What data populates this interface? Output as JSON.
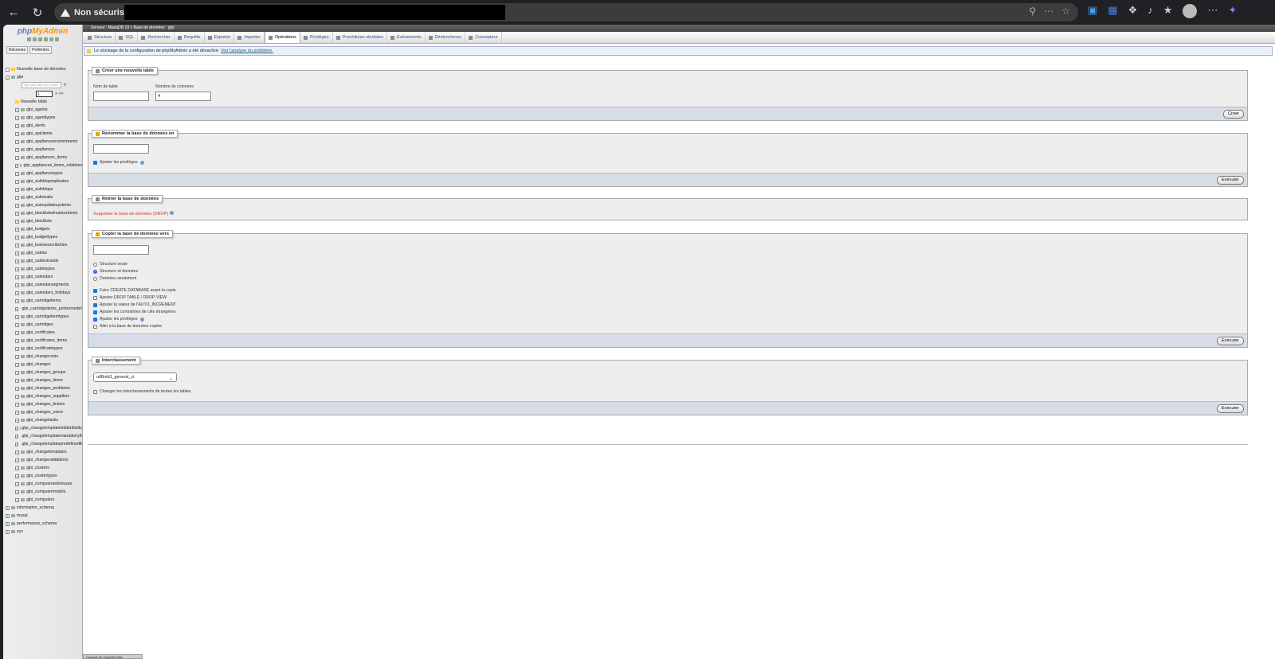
{
  "browser": {
    "security_label": "Non sécurisé"
  },
  "nav": {
    "logo_php": "php",
    "logo_myadmin": "MyAdmin",
    "recent_label": "Récentes",
    "favorites_label": "Préférées",
    "new_db": "Nouvelle base de données",
    "db_name": "glpi",
    "filter_placeholder": "Type your filter and, Enter",
    "filter_clear": "X",
    "pager_value": "1",
    "pager_next": "> >>",
    "new_table": "Nouvelle table",
    "tables": [
      "glpi_agents",
      "glpi_agenttypes",
      "glpi_alerts",
      "glpi_apiclients",
      "glpi_applianceenvironments",
      "glpi_appliances",
      "glpi_appliances_items",
      "glpi_appliances_items_relations",
      "glpi_appliancetypes",
      "glpi_authldapreplicates",
      "glpi_authldaps",
      "glpi_authmails",
      "glpi_autoupdatesystems",
      "glpi_blacklistedmailcontents",
      "glpi_blacklists",
      "glpi_budgets",
      "glpi_budgettypes",
      "glpi_businesscriticities",
      "glpi_cables",
      "glpi_cablestrands",
      "glpi_cabletypes",
      "glpi_calendars",
      "glpi_calendarsegments",
      "glpi_calendars_holidays",
      "glpi_cartridgeitems",
      "glpi_cartridgeitems_printermodels",
      "glpi_cartridgeitemtypes",
      "glpi_cartridges",
      "glpi_certificates",
      "glpi_certificates_items",
      "glpi_certificatetypes",
      "glpi_changecosts",
      "glpi_changes",
      "glpi_changes_groups",
      "glpi_changes_items",
      "glpi_changes_problems",
      "glpi_changes_suppliers",
      "glpi_changes_tickets",
      "glpi_changes_users",
      "glpi_changetasks",
      "glpi_changetemplatehiddenfields",
      "glpi_changetemplatemandatoryfields",
      "glpi_changetemplatepredefinedfields",
      "glpi_changetemplates",
      "glpi_changevalidations",
      "glpi_clusters",
      "glpi_clustertypes",
      "glpi_computerantiviruses",
      "glpi_computermodels",
      "glpi_computers"
    ],
    "other_dbs": [
      "information_schema",
      "mysql",
      "performance_schema",
      "sys"
    ]
  },
  "breadcrumb": {
    "server": "Serveur : MariaDB 10",
    "separator": "»",
    "database": "Base de données : glpi"
  },
  "tabs": [
    {
      "label": "Structure",
      "active": false
    },
    {
      "label": "SQL",
      "active": false
    },
    {
      "label": "Rechercher",
      "active": false
    },
    {
      "label": "Requête",
      "active": false
    },
    {
      "label": "Exporter",
      "active": false
    },
    {
      "label": "Importer",
      "active": false
    },
    {
      "label": "Opérations",
      "active": true
    },
    {
      "label": "Privilèges",
      "active": false
    },
    {
      "label": "Procédures stockées",
      "active": false
    },
    {
      "label": "Événements",
      "active": false
    },
    {
      "label": "Déclencheurs",
      "active": false
    },
    {
      "label": "Concepteur",
      "active": false
    }
  ],
  "notice": {
    "text": "Le stockage de la configuration de phpMyAdmin a été désactivé.",
    "link": "Voir l'analyse du problème."
  },
  "create_table": {
    "legend": "Créer une nouvelle table",
    "name_label": "Nom de table",
    "cols_label": "Nombre de colonnes",
    "name_value": "",
    "cols_value": "4",
    "button": "Créer"
  },
  "rename_db": {
    "legend": "Renommer la base de données en",
    "value": "",
    "adjust_priv": "Ajuster les privilèges",
    "button": "Exécuter"
  },
  "drop_db": {
    "legend": "Retirer la base de données",
    "link": "Supprimer la base de données (DROP)"
  },
  "copy_db": {
    "legend": "Copier la base de données vers",
    "value": "",
    "radios": [
      {
        "label": "Structure seule",
        "checked": false
      },
      {
        "label": "Structure et données",
        "checked": true
      },
      {
        "label": "Données seulement",
        "checked": false
      }
    ],
    "checks": [
      {
        "label": "Faire CREATE DATABASE avant la copie",
        "checked": true
      },
      {
        "label": "Ajouter DROP TABLE / DROP VIEW",
        "checked": false
      },
      {
        "label": "Ajouter la valeur de l'AUTO_INCREMENT",
        "checked": true
      },
      {
        "label": "Ajouter les contraintes de clés étrangères",
        "checked": true
      },
      {
        "label": "Ajuster les privilèges",
        "checked": true
      },
      {
        "label": "Aller à la base de données copiée",
        "checked": false
      }
    ],
    "button": "Exécuter"
  },
  "collation": {
    "legend": "Interclassement",
    "selected": "utf8mb3_general_ci",
    "change_all": "Changer les interclassements de toutes les tables",
    "button": "Exécuter"
  },
  "console": {
    "label": "Console de requêtes SQL"
  }
}
